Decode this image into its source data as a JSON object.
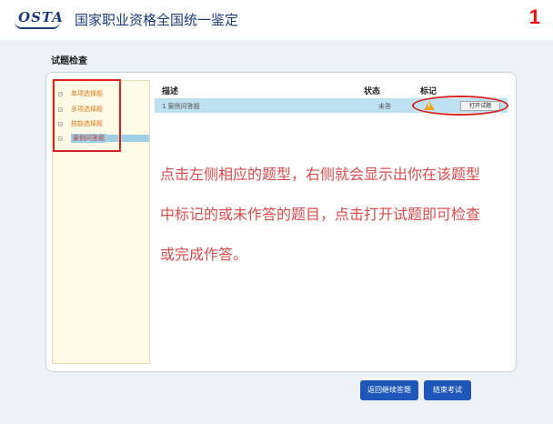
{
  "header": {
    "logo_text": "OSTA",
    "title": "国家职业资格全国统一鉴定",
    "step_number": "1"
  },
  "section": {
    "title": "试题检查"
  },
  "tree": {
    "items": [
      {
        "toggle": "⊟",
        "label": "单项选择题"
      },
      {
        "toggle": "⊟",
        "label": "多项选择题"
      },
      {
        "toggle": "⊟",
        "label": "技能选择题"
      },
      {
        "toggle": "⊟",
        "label": "案例问答题",
        "selected": true
      }
    ]
  },
  "table": {
    "headers": {
      "description": "描述",
      "status": "状态",
      "mark": "标记"
    },
    "rows": [
      {
        "description": "1 案例问答题",
        "status": "未答",
        "mark_icon": "warning-triangle-icon",
        "action": "打开试题"
      }
    ]
  },
  "instruction": {
    "lines": [
      "点击左侧相应的题型，右侧就会显示出你在该题型",
      "中标记的或未作答的题目，点击打开试题即可检查",
      "或完成作答。"
    ]
  },
  "buttons": {
    "return_label": "返回继续答题",
    "end_label": "结束考试"
  },
  "colors": {
    "brand": "#1a3c7a",
    "highlight": "#d22222",
    "instruction_text": "#d94b4b",
    "selected_row": "#bde1f0",
    "button": "#1f57b8",
    "tree_background": "#fffbe6",
    "tree_text": "#e0761b"
  }
}
